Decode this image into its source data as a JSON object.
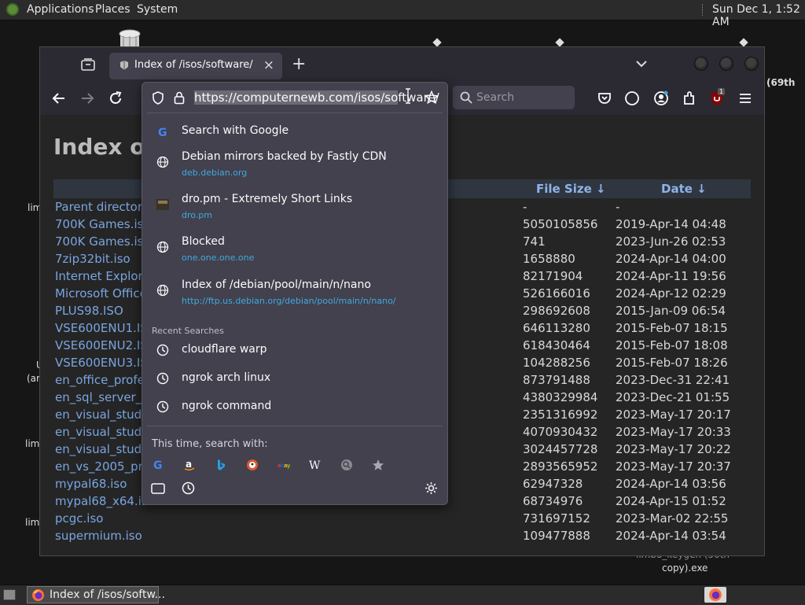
{
  "top_panel": {
    "menus": [
      "Applications",
      "Places",
      "System"
    ],
    "clock": "Sun Dec  1,  1:52 AM"
  },
  "desktop": {
    "labels": [
      "lim",
      "U",
      "(ar",
      "lim",
      "lim",
      "(69th",
      "limbo_keygen (56th",
      "copy).exe"
    ]
  },
  "browser": {
    "tab_title": "Index of /isos/software/",
    "tab_close": "×",
    "new_tab": "+",
    "url": {
      "selected": "https://computernewb.com/isos/so",
      "rest": "ftware/"
    },
    "search_placeholder": "Search",
    "extension_badge": "1"
  },
  "page": {
    "heading": "Index of",
    "columns": {
      "size": "File Size  ↓",
      "date": "Date  ↓"
    },
    "rows": [
      {
        "name": "Parent directory",
        "size": "-",
        "date": "-"
      },
      {
        "name": "700K Games.iso",
        "size": "5050105856",
        "date": "2019-Apr-14 04:48"
      },
      {
        "name": "700K Games.iso",
        "size": "741",
        "date": "2023-Jun-26 02:53"
      },
      {
        "name": "7zip32bit.iso",
        "size": "1658880",
        "date": "2024-Apr-14 04:00"
      },
      {
        "name": "Internet Explore",
        "size": "82171904",
        "date": "2024-Apr-11 19:56"
      },
      {
        "name": "Microsoft Office",
        "size": "526166016",
        "date": "2024-Apr-12 02:29"
      },
      {
        "name": "PLUS98.ISO",
        "size": "298692608",
        "date": "2015-Jan-09 06:54"
      },
      {
        "name": "VSE600ENU1.IS",
        "size": "646113280",
        "date": "2015-Feb-07 18:15"
      },
      {
        "name": "VSE600ENU2.IS",
        "size": "618430464",
        "date": "2015-Feb-07 18:08"
      },
      {
        "name": "VSE600ENU3.IS",
        "size": "104288256",
        "date": "2015-Feb-07 18:26"
      },
      {
        "name": "en_office_profe",
        "size": "873791488",
        "date": "2023-Dec-31 22:41"
      },
      {
        "name": "en_sql_server_2",
        "size": "4380329984",
        "date": "2023-Dec-21 01:55"
      },
      {
        "name": "en_visual_studi",
        "size": "2351316992",
        "date": "2023-May-17 20:17"
      },
      {
        "name": "en_visual_studi",
        "size": "4070930432",
        "date": "2023-May-17 20:33"
      },
      {
        "name": "en_visual_studi",
        "size": "3024457728",
        "date": "2023-May-17 20:22"
      },
      {
        "name": "en_vs_2005_pr",
        "size": "2893565952",
        "date": "2023-May-17 20:37"
      },
      {
        "name": "mypal68.iso",
        "size": "62947328",
        "date": "2024-Apr-14 03:56"
      },
      {
        "name": "mypal68_x64.is",
        "size": "68734976",
        "date": "2024-Apr-15 01:52"
      },
      {
        "name": "pcgc.iso",
        "size": "731697152",
        "date": "2023-Mar-02 22:55"
      },
      {
        "name": "supermium.iso",
        "size": "109477888",
        "date": "2024-Apr-14 03:54"
      }
    ]
  },
  "dropdown": {
    "results": [
      {
        "icon": "google-icon",
        "title": "Search with Google",
        "sub": ""
      },
      {
        "icon": "globe-icon",
        "title": "Debian mirrors backed by Fastly CDN",
        "sub": "deb.debian.org"
      },
      {
        "icon": "dro-pm-favicon",
        "title": "dro.pm - Extremely Short Links",
        "sub": "dro.pm"
      },
      {
        "icon": "globe-icon",
        "title": "Blocked",
        "sub": "one.one.one.one"
      },
      {
        "icon": "globe-icon",
        "title": "Index of /debian/pool/main/n/nano",
        "sub": "http://ftp.us.debian.org/debian/pool/main/n/nano/"
      }
    ],
    "recent_label": "Recent Searches",
    "recent": [
      "cloudflare warp",
      "ngrok arch linux",
      "ngrok command"
    ],
    "oneoff_label": "This time, search with:",
    "engines": [
      "google-icon",
      "amazon-icon",
      "bing-icon",
      "duckduckgo-icon",
      "ebay-icon",
      "wikipedia-icon",
      "search-engine-icon",
      "bookmarks-star-icon"
    ]
  },
  "taskbar": {
    "task_label": "Index of /isos/softw..."
  }
}
